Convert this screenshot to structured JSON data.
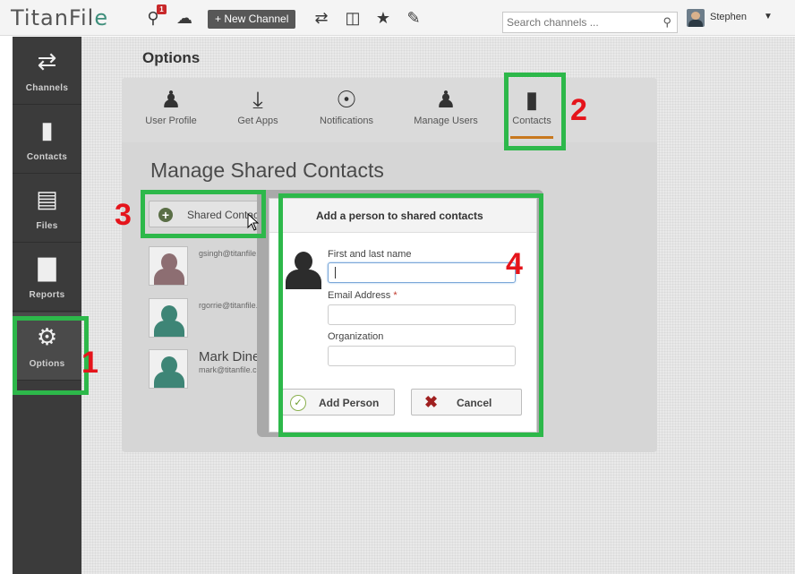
{
  "app": {
    "logo": "TitanFil",
    "logo_accent": "e"
  },
  "topbar": {
    "new_channel_label": "+ New Channel",
    "notification_badge": "1",
    "search_placeholder": "Search channels ...",
    "username": "Stephen"
  },
  "leftnav": {
    "items": [
      {
        "label": "Channels",
        "icon": "arrows-icon"
      },
      {
        "label": "Contacts",
        "icon": "bookmark-icon"
      },
      {
        "label": "Files",
        "icon": "file-icon"
      },
      {
        "label": "Reports",
        "icon": "bar-chart-icon"
      },
      {
        "label": "Options",
        "icon": "gear-icon",
        "active": true
      }
    ]
  },
  "page": {
    "title": "Options",
    "tabs": [
      {
        "label": "User Profile",
        "icon": "user-edit-icon"
      },
      {
        "label": "Get Apps",
        "icon": "download-icon"
      },
      {
        "label": "Notifications",
        "icon": "broadcast-icon"
      },
      {
        "label": "Manage Users",
        "icon": "users-icon"
      },
      {
        "label": "Contacts",
        "icon": "bookmark-icon",
        "active": true
      }
    ],
    "section_title": "Manage Shared Contacts",
    "shared_button_label": "Shared Contacts",
    "contacts": [
      {
        "email": "gsingh@titanfile.com"
      },
      {
        "email": "rgorrie@titanfile.com"
      },
      {
        "name": "Mark Dineen",
        "email": "mark@titanfile.com"
      }
    ]
  },
  "modal": {
    "title": "Add a person to shared contacts",
    "fields": {
      "name_label": "First and last name",
      "email_label": "Email Address",
      "email_required": "*",
      "org_label": "Organization"
    },
    "add_label": "Add Person",
    "cancel_label": "Cancel"
  },
  "annotations": [
    "1",
    "2",
    "3",
    "4"
  ],
  "colors": {
    "highlight": "#2db84a",
    "step_number": "#e5141b",
    "tab_active": "#c8781e",
    "nav_bg": "#3b3b3b"
  }
}
